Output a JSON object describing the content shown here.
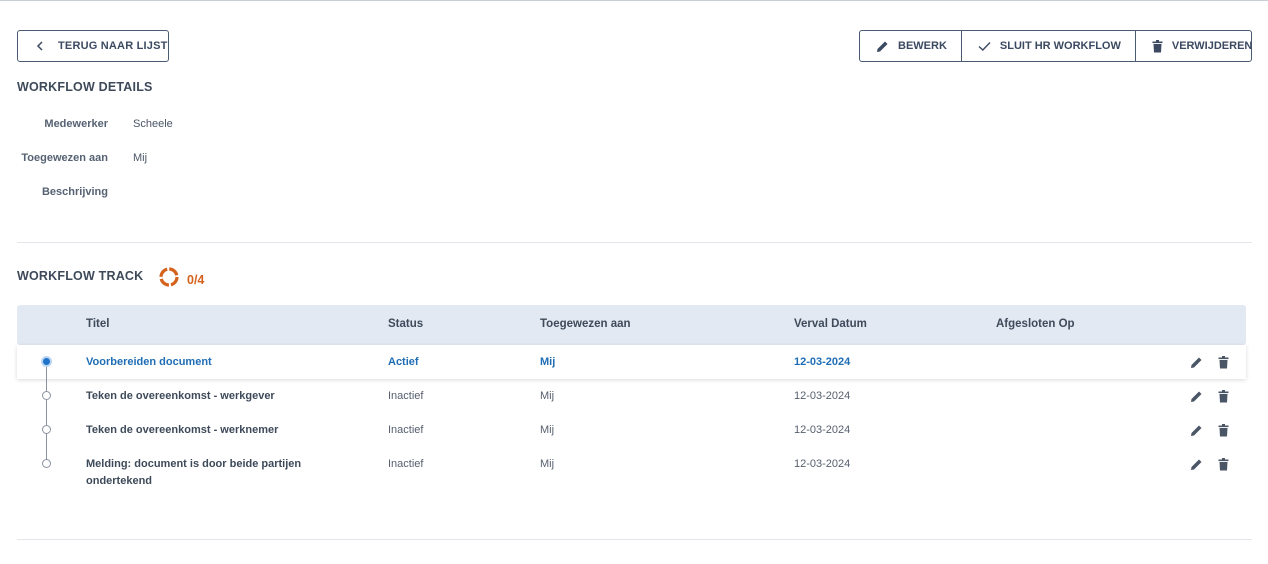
{
  "toolbar": {
    "back_label": "TERUG NAAR LIJST",
    "edit_label": "BEWERK",
    "close_label": "SLUIT HR WORKFLOW",
    "delete_label": "VERWIJDEREN"
  },
  "details": {
    "title": "WORKFLOW DETAILS",
    "fields": [
      {
        "label": "Medewerker",
        "value": "Scheele"
      },
      {
        "label": "Toegewezen aan",
        "value": "Mij"
      },
      {
        "label": "Beschrijving",
        "value": ""
      }
    ]
  },
  "track": {
    "title": "WORKFLOW TRACK",
    "progress_text": "0/4",
    "progress_fraction": 0,
    "progress_color": "#d4621c",
    "columns": [
      "Titel",
      "Status",
      "Toegewezen aan",
      "Verval Datum",
      "Afgesloten Op"
    ],
    "rows": [
      {
        "title": "Voorbereiden document",
        "status": "Actief",
        "assignee": "Mij",
        "due": "12-03-2024",
        "closed": "",
        "active": true
      },
      {
        "title": "Teken de overeenkomst - werkgever",
        "status": "Inactief",
        "assignee": "Mij",
        "due": "12-03-2024",
        "closed": "",
        "active": false
      },
      {
        "title": "Teken de overeenkomst - werknemer",
        "status": "Inactief",
        "assignee": "Mij",
        "due": "12-03-2024",
        "closed": "",
        "active": false
      },
      {
        "title": "Melding: document is door beide partijen ondertekend",
        "status": "Inactief",
        "assignee": "Mij",
        "due": "12-03-2024",
        "closed": "",
        "active": false
      }
    ]
  },
  "colors": {
    "accent_blue": "#1f6db5",
    "header_bg": "#e3e9f2",
    "text": "#3e4a5a"
  },
  "icons": {
    "back": "chevron-left-icon",
    "edit": "pencil-icon",
    "close": "check-icon",
    "delete": "trash-icon",
    "progress": "progress-ring-icon"
  }
}
